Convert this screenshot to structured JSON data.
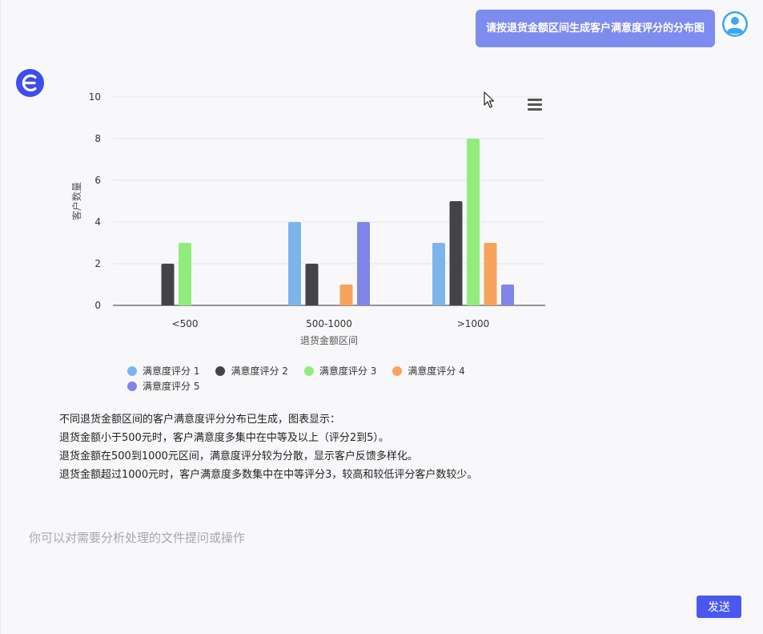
{
  "conversation": {
    "user_message": "请按退货金额区间生成客户满意度评分的分布图",
    "answer_lines": [
      "不同退货金额区间的客户满意度评分分布已生成，图表显示：",
      "退货金额小于500元时，客户满意度多集中在中等及以上（评分2到5）。",
      "退货金额在500到1000元区间，满意度评分较为分散，显示客户反馈多样化。",
      "退货金额超过1000元时，客户满意度多数集中在中等评分3，较高和较低评分客户数较少。"
    ]
  },
  "input": {
    "placeholder": "你可以对需要分析处理的文件提问或操作",
    "value": ""
  },
  "send_label": "发送",
  "colors": {
    "user_bubble": "#7e8cf0",
    "send_button": "#4a58f0",
    "bot_avatar": "#3d4df0",
    "user_avatar": "#3ba7f5"
  },
  "icons": {
    "user_avatar": "user-avatar-icon",
    "bot_avatar": "bot-logo-icon",
    "menu": "hamburger-menu-icon",
    "cursor": "mouse-cursor-icon"
  },
  "chart_data": {
    "type": "bar",
    "title": "",
    "xlabel": "退货金额区间",
    "ylabel": "客户数量",
    "ylim": [
      0,
      10
    ],
    "yticks": [
      0,
      2,
      4,
      6,
      8,
      10
    ],
    "categories": [
      "<500",
      "500-1000",
      ">1000"
    ],
    "grid": true,
    "legend_position": "bottom",
    "series": [
      {
        "name": "满意度评分 1",
        "color": "#7cb5ec",
        "values": [
          0,
          4,
          3
        ]
      },
      {
        "name": "满意度评分 2",
        "color": "#434348",
        "values": [
          2,
          2,
          5
        ]
      },
      {
        "name": "满意度评分 3",
        "color": "#90ed7d",
        "values": [
          3,
          0,
          8
        ]
      },
      {
        "name": "满意度评分 4",
        "color": "#f7a35c",
        "values": [
          0,
          1,
          3
        ]
      },
      {
        "name": "满意度评分 5",
        "color": "#8085e9",
        "values": [
          0,
          4,
          1
        ]
      }
    ]
  }
}
